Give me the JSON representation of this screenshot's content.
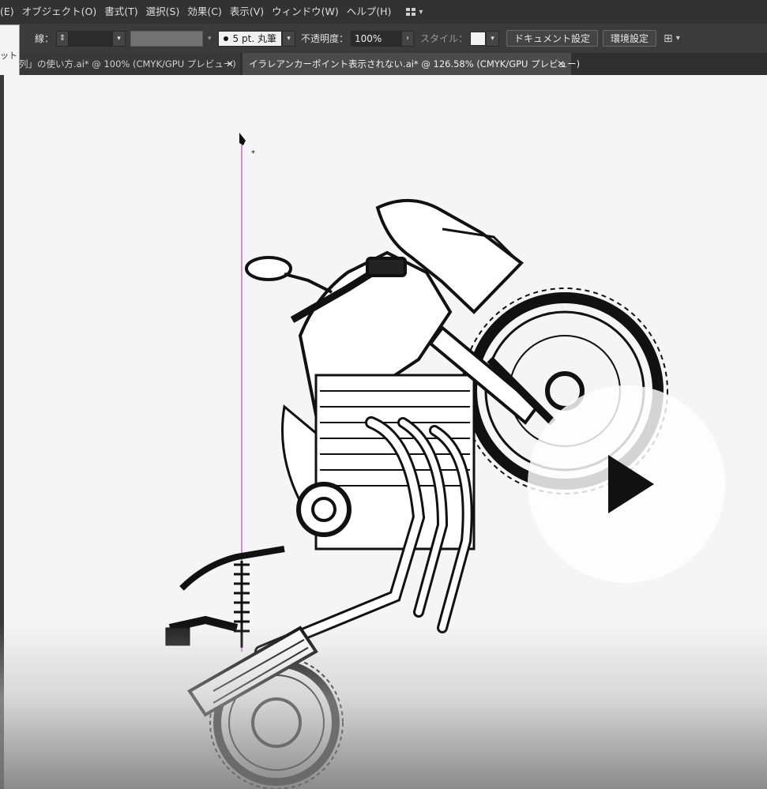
{
  "menu": {
    "items": [
      "(E)",
      "オブジェクト(O)",
      "書式(T)",
      "選択(S)",
      "効果(C)",
      "表示(V)",
      "ウィンドウ(W)",
      "ヘルプ(H)"
    ],
    "workspace_icon": "workspace-grid-icon"
  },
  "control_bar": {
    "stroke_label": "線：",
    "brush_label": "5 pt. 丸筆",
    "opacity_label": "不透明度：",
    "opacity_value": "100%",
    "style_label": "スタイル：",
    "doc_settings_button": "ドキュメント設定",
    "env_settings_button": "環境設定"
  },
  "flyout": {
    "text": "ット"
  },
  "tabs": [
    {
      "label": "列」の使い方.ai* @ 100% (CMYK/GPU プレビュー)",
      "active": false
    },
    {
      "label": "イラレアンカーポイント表示されない.ai* @ 126.58% (CMYK/GPU プレビュー)",
      "active": true
    }
  ],
  "canvas": {
    "artwork": "motorcycle-line-art",
    "overlay": "play-button",
    "cursor": "pen-tool-cursor"
  },
  "colors": {
    "menubar": "#323232",
    "controlbar": "#3b3b3b",
    "guide_line": "#b04fb8",
    "canvas": "#f5f5f5"
  }
}
